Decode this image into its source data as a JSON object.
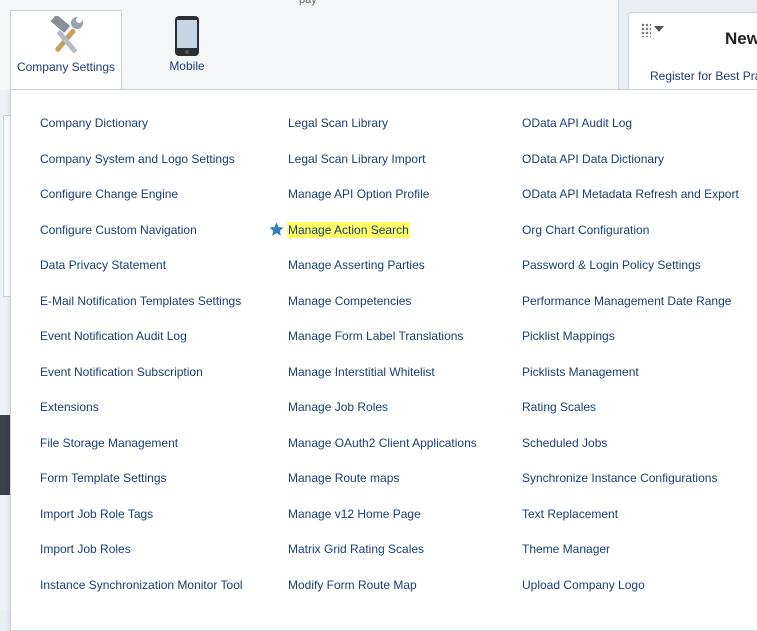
{
  "header": {
    "pay_fragment": "pay",
    "tiles": [
      {
        "label": "Company Settings",
        "icon": "tools-icon"
      },
      {
        "label": "Mobile",
        "icon": "mobile-phone-icon"
      }
    ]
  },
  "right_panel": {
    "title": "New",
    "link": "Register for Best Pra"
  },
  "menu": {
    "columns": [
      [
        "Company Dictionary",
        "Company System and Logo Settings",
        "Configure Change Engine",
        "Configure Custom Navigation",
        "Data Privacy Statement",
        "E-Mail Notification Templates Settings",
        "Event Notification Audit Log",
        "Event Notification Subscription",
        "Extensions",
        "File Storage Management",
        "Form Template Settings",
        "Import Job Role Tags",
        "Import Job Roles",
        "Instance Synchronization Monitor Tool"
      ],
      [
        "Legal Scan Library",
        "Legal Scan Library Import",
        "Manage API Option Profile",
        "Manage Action Search",
        "Manage Asserting Parties",
        "Manage Competencies",
        "Manage Form Label Translations",
        "Manage Interstitial Whitelist",
        "Manage Job Roles",
        "Manage OAuth2 Client Applications",
        "Manage Route maps",
        "Manage v12 Home Page",
        "Matrix Grid Rating Scales",
        "Modify Form Route Map"
      ],
      [
        "OData API Audit Log",
        "OData API Data Dictionary",
        "OData API Metadata Refresh and Export",
        "Org Chart Configuration",
        "Password & Login Policy Settings",
        "Performance Management Date Range",
        "Picklist Mappings",
        "Picklists Management",
        "Rating Scales",
        "Scheduled Jobs",
        "Synchronize Instance Configurations",
        "Text Replacement",
        "Theme Manager",
        "Upload Company Logo"
      ]
    ],
    "highlighted": {
      "column": 1,
      "index": 3,
      "color": "#ffff66",
      "star_color": "#2f7fc1"
    }
  },
  "colors": {
    "link": "#1a3f73",
    "highlight": "#ffff66",
    "border": "#c9d3dc"
  }
}
